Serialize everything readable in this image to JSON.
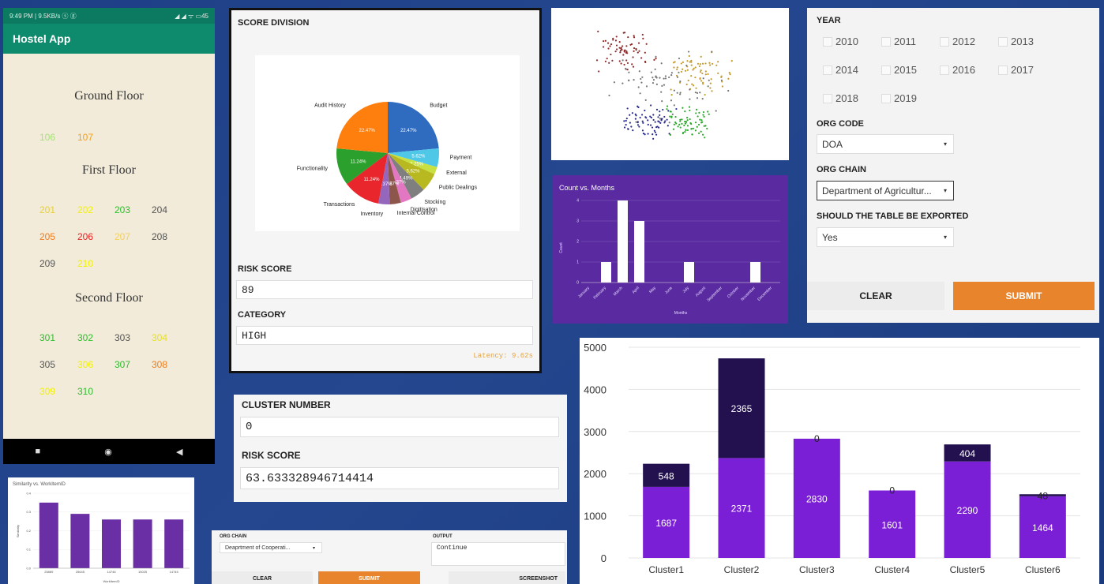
{
  "phone": {
    "status_left": "9:49 PM | 9.5KB/s ⓢ ⓖ",
    "status_right": "◢ ◢ ᯤ ▭45",
    "app_title": "Hostel App",
    "floors": [
      {
        "label": "Ground Floor",
        "rooms": [
          {
            "num": "106",
            "color": "#a7e07a"
          },
          {
            "num": "107",
            "color": "#f0a020"
          }
        ]
      },
      {
        "label": "First Floor",
        "rooms": [
          {
            "num": "201",
            "color": "#e8d030"
          },
          {
            "num": "202",
            "color": "#f2f200"
          },
          {
            "num": "203",
            "color": "#2ebd2e"
          },
          {
            "num": "204",
            "color": "#555555"
          },
          {
            "num": "205",
            "color": "#ef7d1f"
          },
          {
            "num": "206",
            "color": "#ee2222"
          },
          {
            "num": "207",
            "color": "#f2d060"
          },
          {
            "num": "208",
            "color": "#555555"
          },
          {
            "num": "209",
            "color": "#555555"
          },
          {
            "num": "210",
            "color": "#f2f200"
          }
        ]
      },
      {
        "label": "Second Floor",
        "rooms": [
          {
            "num": "301",
            "color": "#2ebd2e"
          },
          {
            "num": "302",
            "color": "#2ebd2e"
          },
          {
            "num": "303",
            "color": "#555555"
          },
          {
            "num": "304",
            "color": "#e8e020"
          },
          {
            "num": "305",
            "color": "#555555"
          },
          {
            "num": "306",
            "color": "#f2f200"
          },
          {
            "num": "307",
            "color": "#2ebd2e"
          },
          {
            "num": "308",
            "color": "#ef7d1f"
          },
          {
            "num": "309",
            "color": "#f2f200"
          },
          {
            "num": "310",
            "color": "#2ebd2e"
          }
        ]
      }
    ],
    "nav": [
      "■",
      "◉",
      "◀"
    ]
  },
  "score": {
    "title": "SCORE DIVISION",
    "risk_label": "RISK SCORE",
    "risk_value": "89",
    "category_label": "CATEGORY",
    "category_value": "HIGH",
    "latency": "Latency: 9.62s",
    "pie": {
      "slices": [
        {
          "name": "Budget",
          "pct": "22.47%",
          "value": 22.47,
          "color": "#2f6cc0"
        },
        {
          "name": "Payment",
          "pct": "5.62%",
          "value": 5.62,
          "color": "#4fc8e8"
        },
        {
          "name": "External",
          "pct": "2.25%",
          "value": 2.25,
          "color": "#c8e040"
        },
        {
          "name": "Public Dealings",
          "pct": "5.62%",
          "value": 5.62,
          "color": "#b8b820"
        },
        {
          "name": "Stocking",
          "pct": "4.49%",
          "value": 4.49,
          "color": "#7f7f7f"
        },
        {
          "name": "Digitisation",
          "pct": "3.37%",
          "value": 3.37,
          "color": "#e377c2"
        },
        {
          "name": "Internal Control",
          "pct": "3.37%",
          "value": 3.37,
          "color": "#8c564b"
        },
        {
          "name": "Inventory",
          "pct": "3.37%",
          "value": 3.37,
          "color": "#9467bd"
        },
        {
          "name": "Transactions",
          "pct": "11.24%",
          "value": 11.24,
          "color": "#e8262b"
        },
        {
          "name": "Functionality",
          "pct": "11.24%",
          "value": 11.24,
          "color": "#2ca02c"
        },
        {
          "name": "Audit History",
          "pct": "22.47%",
          "value": 22.47,
          "color": "#ff7f0e"
        }
      ]
    }
  },
  "months_chart": {
    "chart_data": {
      "type": "bar",
      "title": "Count vs. Months",
      "xlabel": "Months",
      "ylabel": "Count",
      "categories": [
        "January",
        "February",
        "March",
        "April",
        "May",
        "June",
        "July",
        "August",
        "September",
        "October",
        "November",
        "December"
      ],
      "values": [
        0,
        1,
        4,
        3,
        0,
        0,
        1,
        0,
        0,
        0,
        1,
        0
      ],
      "ylim": [
        0,
        4
      ],
      "yticks": [
        "0",
        "1",
        "2",
        "3",
        "4"
      ]
    }
  },
  "form": {
    "year_label": "YEAR",
    "years": [
      "2010",
      "2011",
      "2012",
      "2013",
      "2014",
      "2015",
      "2016",
      "2017",
      "2018",
      "2019"
    ],
    "org_code_label": "ORG CODE",
    "org_code_value": "DOA",
    "org_chain_label": "ORG CHAIN",
    "org_chain_value": "Department of Agricultur...",
    "export_label": "SHOULD THE TABLE BE EXPORTED",
    "export_value": "Yes",
    "clear_label": "CLEAR",
    "submit_label": "SUBMIT",
    "accent": "#e8842c"
  },
  "cluster": {
    "cluster_label": "CLUSTER NUMBER",
    "cluster_value": "0",
    "risk_label": "RISK SCORE",
    "risk_value": "63.633328946714414"
  },
  "stacked": {
    "chart_data": {
      "type": "bar",
      "categories": [
        "Cluster1",
        "Cluster2",
        "Cluster3",
        "Cluster4",
        "Cluster5",
        "Cluster6"
      ],
      "series": [
        {
          "values": [
            1687,
            2371,
            2830,
            1601,
            2290,
            1464
          ],
          "color": "#7b1fd6"
        },
        {
          "values": [
            548,
            2365,
            0,
            0,
            404,
            48
          ],
          "color": "#22104f"
        }
      ],
      "ylim": [
        0,
        5000
      ],
      "yticks": [
        "0",
        "1000",
        "2000",
        "3000",
        "4000",
        "5000"
      ]
    }
  },
  "similarity": {
    "chart_data": {
      "type": "bar",
      "title": "Similarity vs. WorkItemID",
      "xlabel": "WorkItemID",
      "ylabel": "Similarity",
      "categories": [
        "25889",
        "25645",
        "14746",
        "15025",
        "14745"
      ],
      "values": [
        0.35,
        0.29,
        0.26,
        0.26,
        0.26
      ],
      "ylim": [
        0,
        0.4
      ],
      "yticks": [
        "0.0",
        "0.1",
        "0.2",
        "0.3",
        "0.4"
      ]
    }
  },
  "bottom_form": {
    "org_chain_label": "ORG CHAIN",
    "org_chain_value": "Deaprtment of Cooperati...",
    "output_label": "OUTPUT",
    "output_value": "Continue",
    "clear_label": "CLEAR",
    "submit_label": "SUBMIT",
    "screenshot_label": "SCREENSHOT"
  }
}
